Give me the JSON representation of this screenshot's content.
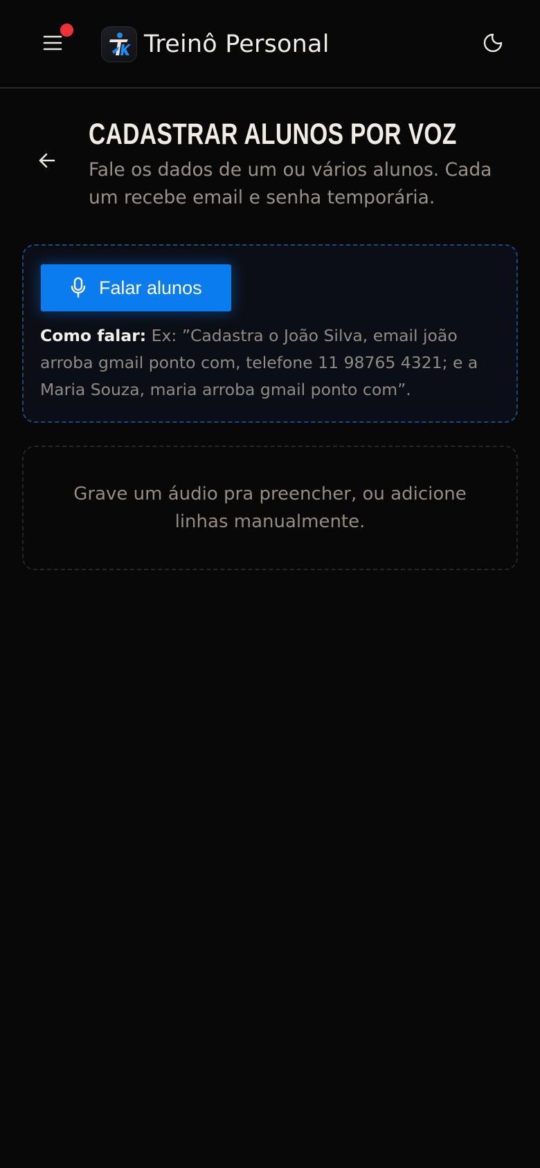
{
  "header": {
    "app_title": "Treinô Personal",
    "menu_icon": "menu-icon",
    "theme_icon": "moon-icon",
    "notification_color": "#ef3139"
  },
  "page": {
    "title": "CADASTRAR ALUNOS POR VOZ",
    "subtitle": "Fale os dados de um ou vários alunos. Cada um recebe email e senha temporária.",
    "back_icon": "arrow-left-icon"
  },
  "voice_card": {
    "speak_button_label": "Falar alunos",
    "mic_icon": "mic-icon",
    "hint_label": "Como falar:",
    "hint_text": "Ex: ”Cadastra o João Silva, email joão arroba gmail ponto com, telefone 11 98765 4321; e a Maria Souza, maria arroba gmail ponto com”.",
    "accent_color": "#0a7ced"
  },
  "empty_state": {
    "text": "Grave um áudio pra preencher, ou adicione linhas manualmente."
  }
}
